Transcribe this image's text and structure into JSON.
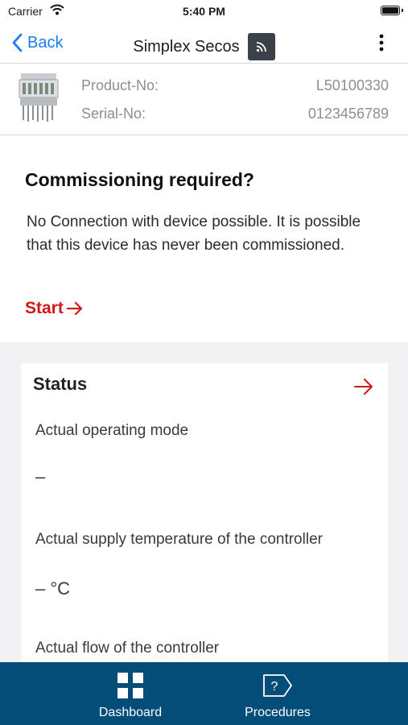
{
  "status_bar": {
    "carrier": "Carrier",
    "time": "5:40 PM"
  },
  "nav": {
    "back_label": "Back",
    "title": "Simplex Secos"
  },
  "product": {
    "product_no_label": "Product-No:",
    "product_no_value": "L50100330",
    "serial_no_label": "Serial-No:",
    "serial_no_value": "0123456789"
  },
  "commission": {
    "title": "Commissioning required?",
    "text": "No Connection with device possible. It is possible that this device has never been commissioned.",
    "start_label": "Start"
  },
  "status_card": {
    "title": "Status",
    "fields": [
      {
        "label": "Actual operating mode",
        "value": "–"
      },
      {
        "label": "Actual supply temperature of the controller",
        "value": "– °C"
      },
      {
        "label": "Actual flow of the controller",
        "value": ""
      }
    ]
  },
  "tabs": [
    {
      "label": "Dashboard",
      "icon": "dashboard-grid-icon"
    },
    {
      "label": "Procedures",
      "icon": "procedures-tag-icon"
    }
  ],
  "colors": {
    "link_blue": "#1a7cf2",
    "accent_red": "#d21818",
    "tabbar": "#034d79"
  }
}
